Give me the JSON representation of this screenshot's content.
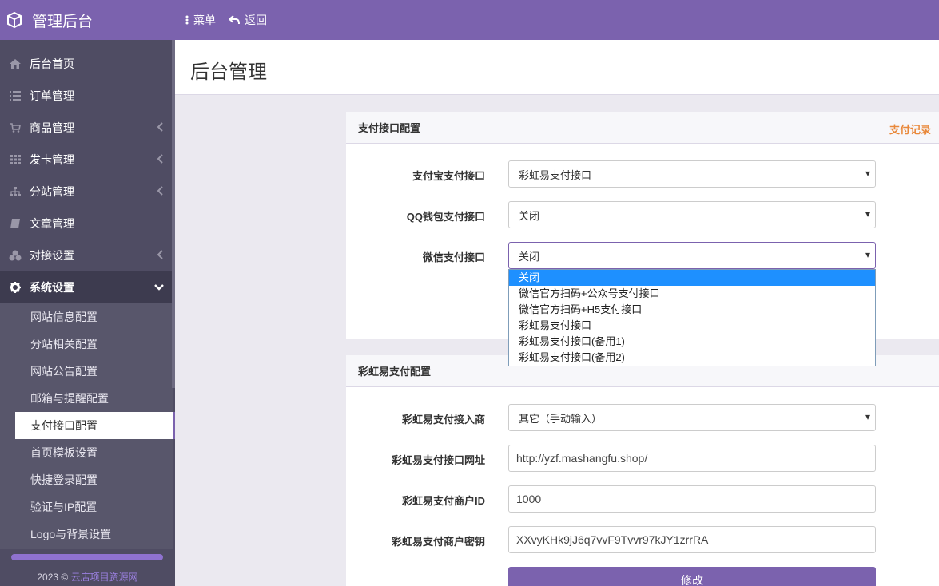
{
  "brand": {
    "title": "管理后台",
    "icon": "cube-icon"
  },
  "topnav": {
    "menu_label": "菜单",
    "back_label": "返回"
  },
  "sidebar": {
    "items": [
      {
        "label": "后台首页",
        "icon": "home-icon"
      },
      {
        "label": "订单管理",
        "icon": "list-icon"
      },
      {
        "label": "商品管理",
        "icon": "cart-icon"
      },
      {
        "label": "发卡管理",
        "icon": "grid-icon"
      },
      {
        "label": "分站管理",
        "icon": "sitemap-icon"
      },
      {
        "label": "文章管理",
        "icon": "book-icon"
      },
      {
        "label": "对接设置",
        "icon": "cubes-icon"
      },
      {
        "label": "系统设置",
        "icon": "gear-icon"
      }
    ],
    "submenu": [
      "网站信息配置",
      "分站相关配置",
      "网站公告配置",
      "邮箱与提醒配置",
      "支付接口配置",
      "首页模板设置",
      "快捷登录配置",
      "验证与IP配置",
      "Logo与背景设置"
    ],
    "current_sub": "支付接口配置",
    "footer": {
      "year": "2023 ©",
      "link": "云店项目资源网"
    }
  },
  "page": {
    "title": "后台管理"
  },
  "pay_panel": {
    "title": "支付接口配置",
    "record_link": "支付记录",
    "alipay_label": "支付宝支付接口",
    "alipay_value": "彩虹易支付接口",
    "qq_label": "QQ钱包支付接口",
    "qq_value": "关闭",
    "wx_label": "微信支付接口",
    "wx_value": "关闭",
    "wx_options": [
      "关闭",
      "微信官方扫码+公众号支付接口",
      "微信官方扫码+H5支付接口",
      "彩虹易支付接口",
      "彩虹易支付接口(备用1)",
      "彩虹易支付接口(备用2)"
    ]
  },
  "epay_panel": {
    "title": "彩虹易支付配置",
    "provider_label": "彩虹易支付接入商",
    "provider_value": "其它（手动输入）",
    "url_label": "彩虹易支付接口网址",
    "url_value": "http://yzf.mashangfu.shop/",
    "pid_label": "彩虹易支付商户ID",
    "pid_value": "1000",
    "key_label": "彩虹易支付商户密钥",
    "key_value": "XXvyKHk9jJ6q7vvF9Tvvr97kJY1zrrRA",
    "submit_label": "修改"
  },
  "colors": {
    "accent": "#7b62ae",
    "sidebar": "#4f4c63",
    "link_orange": "#e9883a"
  }
}
